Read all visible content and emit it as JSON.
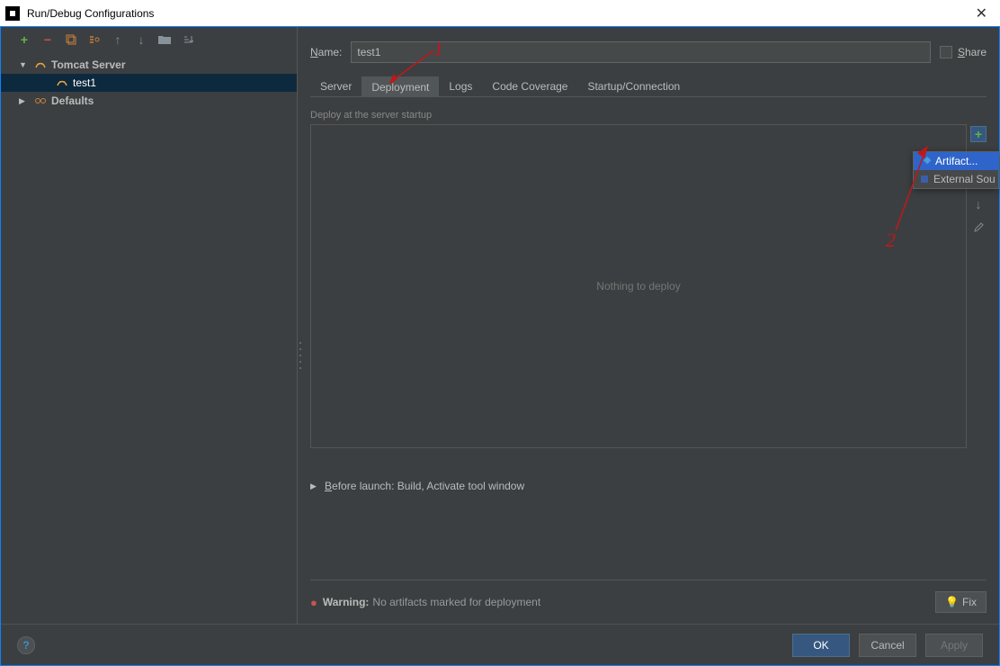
{
  "title": "Run/Debug Configurations",
  "tree": {
    "node1": "Tomcat Server",
    "child1": "test1",
    "node2": "Defaults"
  },
  "form": {
    "name_label_pre": "N",
    "name_label_post": "ame:",
    "name_value": "test1",
    "share_label": "Share",
    "share_u": "S"
  },
  "tabs": {
    "server": "Server",
    "deployment": "Deployment",
    "logs": "Logs",
    "coverage": "Code Coverage",
    "startup": "Startup/Connection"
  },
  "deploy": {
    "section_label": "Deploy at the server startup",
    "empty_text": "Nothing to deploy"
  },
  "before": {
    "label_pre": "B",
    "label_post": "efore launch: Build, Activate tool window"
  },
  "warning": {
    "label": "Warning:",
    "text": "No artifacts marked for deployment",
    "fix": "Fix"
  },
  "buttons": {
    "ok": "OK",
    "cancel": "Cancel",
    "apply": "Apply"
  },
  "popup": {
    "item1": "Artifact...",
    "item2": "External Sou"
  },
  "annotations": {
    "a1": "1",
    "a2": "2"
  }
}
